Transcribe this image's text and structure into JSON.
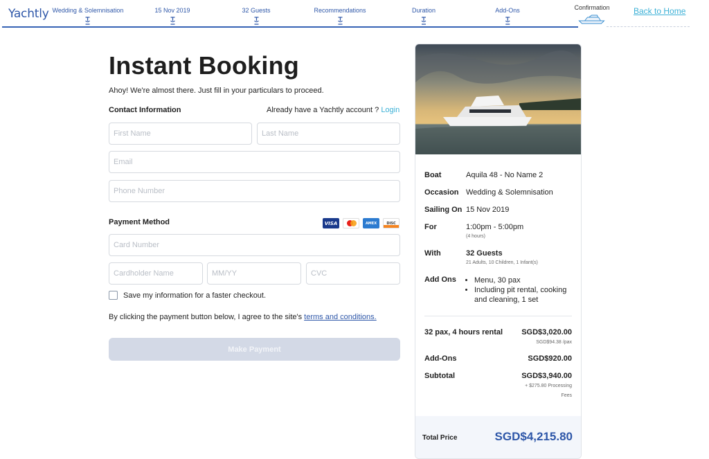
{
  "app": {
    "logo": "Yachtly",
    "back_home": "Back to Home"
  },
  "steps": [
    {
      "label": "Wedding & Solemnisation",
      "icon": "boat-step-icon"
    },
    {
      "label": "15 Nov 2019",
      "icon": "boat-step-icon"
    },
    {
      "label": "32 Guests",
      "icon": "boat-step-icon"
    },
    {
      "label": "Recommendations",
      "icon": "boat-step-icon"
    },
    {
      "label": "Duration",
      "icon": "boat-step-icon"
    },
    {
      "label": "Add-Ons",
      "icon": "boat-step-icon"
    },
    {
      "label": "Confirmation",
      "icon": "yacht-icon"
    }
  ],
  "form": {
    "title": "Instant Booking",
    "subtitle": "Ahoy! We're almost there. Just fill in your particulars to proceed.",
    "contact_label": "Contact Information",
    "account_prompt": "Already have a Yachtly account ?",
    "login_link": "Login",
    "first_name_placeholder": "First Name",
    "last_name_placeholder": "Last Name",
    "email_placeholder": "Email",
    "phone_placeholder": "Phone Number",
    "payment_label": "Payment Method",
    "card_icons": [
      "VISA",
      "mastercard",
      "AMEX",
      "DISCOVER"
    ],
    "card_number_placeholder": "Card Number",
    "cardholder_placeholder": "Cardholder Name",
    "expiry_placeholder": "MM/YY",
    "cvc_placeholder": "CVC",
    "save_info_label": "Save my information for a faster checkout.",
    "agree_text": "By clicking the payment button below, I agree to the site's",
    "terms_link": "terms and conditions.",
    "pay_button": "Make Payment"
  },
  "summary": {
    "boat_label": "Boat",
    "boat": "Aquila 48 - No Name 2",
    "occasion_label": "Occasion",
    "occasion": "Wedding & Solemnisation",
    "sailing_label": "Sailing On",
    "sailing": "15 Nov 2019",
    "for_label": "For",
    "time": "1:00pm - 5:00pm",
    "duration": "(4 hours)",
    "with_label": "With",
    "guests": "32 Guests",
    "guests_detail": "21 Adults, 10 Children, 1 Infant(s)",
    "addons_label": "Add Ons",
    "addons": [
      "Menu, 30 pax",
      "Including pit rental, cooking and cleaning, 1 set"
    ],
    "rental_label": "32 pax, 4 hours rental",
    "rental_amount": "SGD$3,020.00",
    "rental_per_pax": "SGD$94.38 /pax",
    "addons_total_label": "Add-Ons",
    "addons_total": "SGD$920.00",
    "subtotal_label": "Subtotal",
    "subtotal": "SGD$3,940.00",
    "processing_note_1": "+ $275.80 Processing",
    "processing_note_2": "Fees",
    "total_label": "Total Price",
    "total": "SGD$4,215.80"
  },
  "colors": {
    "brand": "#2d56a8",
    "link": "#3bb0d6",
    "button_disabled": "#d3d9e6"
  }
}
